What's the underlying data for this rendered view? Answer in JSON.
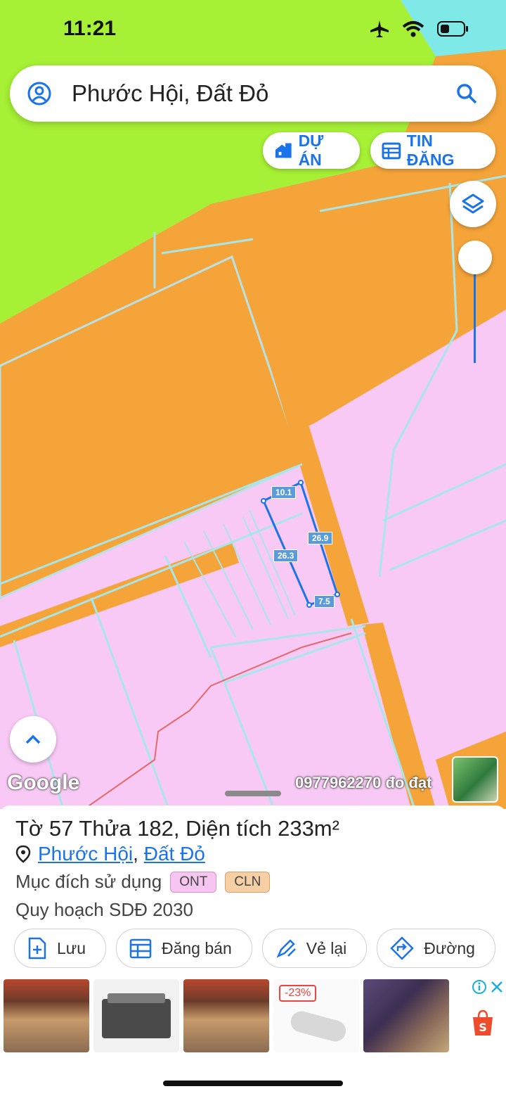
{
  "status_bar": {
    "time": "11:21"
  },
  "search": {
    "query": "Phước Hội, Đất Đỏ"
  },
  "chips": {
    "project_label": "DỰ ÁN",
    "listing_label": "TIN ĐĂNG"
  },
  "map": {
    "dimensions": {
      "top": "10.1",
      "right": "26.9",
      "left": "26.3",
      "bottom": "7.5"
    },
    "google_logo": "Google",
    "overlay_text": "0977962270 đo đạt"
  },
  "parcel": {
    "title": "Tờ 57 Thửa 182, Diện tích 233m²",
    "ward": "Phước Hội",
    "separator": ",",
    "district": "Đất Đỏ",
    "purpose_label": "Mục đích sử dụng",
    "purpose_codes": [
      "ONT",
      "CLN"
    ],
    "plan": "Quy hoạch SDĐ 2030"
  },
  "actions": {
    "save": "Lưu",
    "sell": "Đăng bán",
    "redraw": "Vẻ lại",
    "route": "Đường"
  },
  "ads": {
    "discount": "-23%"
  },
  "colors": {
    "accent": "#1a73e8",
    "residential": "#f9c9f5",
    "orange": "#f5a43a",
    "green": "#a6f035",
    "ont_badge": "#f6c6f1",
    "cln_badge": "#f7cfa4"
  }
}
